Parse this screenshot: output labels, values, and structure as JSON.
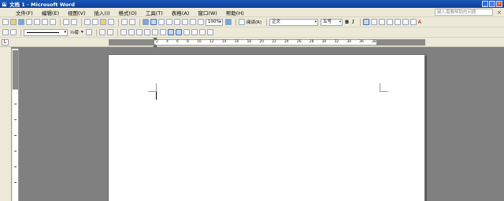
{
  "window": {
    "title": "文档 1 - Microsoft Word",
    "app_icon": "W",
    "controls": {
      "minimize": "_",
      "maximize": "□",
      "close": "×"
    }
  },
  "menu": {
    "items": [
      "文件(F)",
      "编辑(E)",
      "视图(V)",
      "插入(I)",
      "格式(O)",
      "工具(T)",
      "表格(A)",
      "窗口(W)",
      "帮助(H)"
    ],
    "help_placeholder": "键入需要帮助的问题",
    "close_glyph": "×"
  },
  "toolbar_standard": {
    "zoom": "100%",
    "reading_label": "阅读(R)"
  },
  "toolbar_format": {
    "style": "正文",
    "font_size": "五号",
    "bold": "B",
    "italic": "I",
    "font_color_label": "A"
  },
  "toolbar_drawing": {
    "line_weight": "½磅",
    "arrow": "▾"
  },
  "ruler": {
    "tab_glyph": "L",
    "numbers": [
      "2",
      "4",
      "6",
      "8",
      "10",
      "12",
      "14",
      "16",
      "18",
      "20",
      "22",
      "24",
      "26",
      "28",
      "30",
      "32",
      "34",
      "36",
      "38"
    ]
  }
}
